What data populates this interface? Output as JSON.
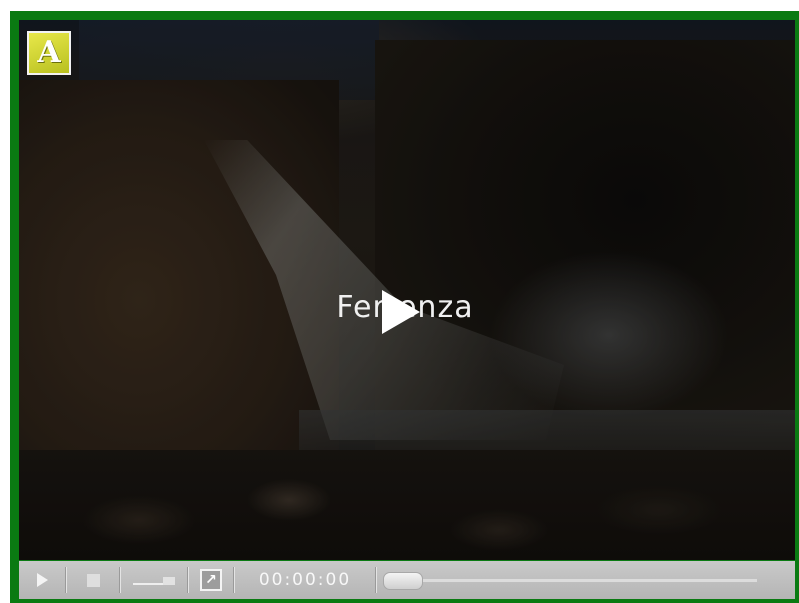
{
  "player": {
    "title": "Ferrenza",
    "badge_letter": "A",
    "border_color": "#0a7a12"
  },
  "controls": {
    "play_icon": "play-icon",
    "stop_icon": "stop-icon",
    "volume_icon": "volume-icon",
    "fullscreen_icon": "fullscreen-icon",
    "fullscreen_glyph": "↗",
    "time": "00:00:00",
    "progress_fraction": 0.0
  }
}
